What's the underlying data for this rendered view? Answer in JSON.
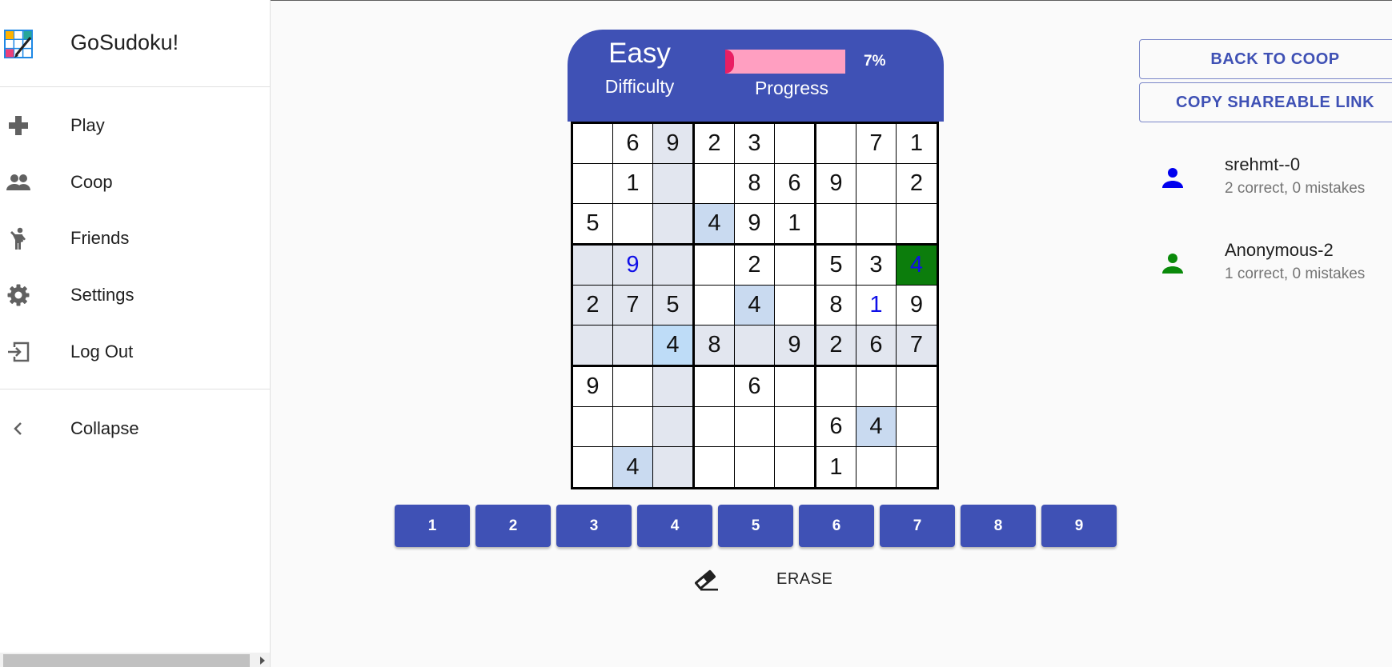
{
  "app": {
    "title": "GoSudoku!"
  },
  "sidebar": {
    "items": [
      {
        "label": "Play",
        "icon": "gamepad-icon"
      },
      {
        "label": "Coop",
        "icon": "people-icon"
      },
      {
        "label": "Friends",
        "icon": "person-waving-icon"
      },
      {
        "label": "Settings",
        "icon": "gear-icon"
      },
      {
        "label": "Log Out",
        "icon": "logout-icon"
      }
    ],
    "collapse": {
      "label": "Collapse",
      "icon": "chevron-left-icon"
    }
  },
  "game": {
    "difficulty_value": "Easy",
    "difficulty_label": "Difficulty",
    "progress_label": "Progress",
    "progress_percent": 7,
    "progress_text": "7%"
  },
  "board": {
    "values": [
      [
        "",
        "6",
        "9",
        "2",
        "3",
        "",
        "",
        "7",
        "1"
      ],
      [
        "",
        "1",
        "",
        "",
        "8",
        "6",
        "9",
        "",
        "2"
      ],
      [
        "5",
        "",
        "",
        "4",
        "9",
        "1",
        "",
        "",
        ""
      ],
      [
        "",
        "9",
        "",
        "",
        "2",
        "",
        "5",
        "3",
        "4"
      ],
      [
        "2",
        "7",
        "5",
        "",
        "4",
        "",
        "8",
        "1",
        "9"
      ],
      [
        "",
        "",
        "4",
        "8",
        "",
        "9",
        "2",
        "6",
        "7"
      ],
      [
        "9",
        "",
        "",
        "",
        "6",
        "",
        "",
        "",
        ""
      ],
      [
        "",
        "",
        "",
        "",
        "",
        "",
        "6",
        "4",
        ""
      ],
      [
        "",
        "4",
        "",
        "",
        "",
        "",
        "1",
        "",
        ""
      ]
    ],
    "user_entries": [
      [
        3,
        1
      ],
      [
        3,
        8
      ],
      [
        4,
        7
      ]
    ],
    "selected": [
      5,
      2
    ],
    "correct_cells": [
      [
        3,
        8
      ]
    ],
    "highlight_color": "#e2e6ef",
    "match_color": "#c9daf0",
    "selected_color": "#bedcf7",
    "correct_color": "#0c7d0c",
    "user_text_color": "#1010e8"
  },
  "numpad": {
    "buttons": [
      "1",
      "2",
      "3",
      "4",
      "5",
      "6",
      "7",
      "8",
      "9"
    ]
  },
  "actions": {
    "erase_label": "ERASE",
    "erase_icon": "eraser-icon"
  },
  "coop": {
    "back_label": "BACK TO COOP",
    "copy_link_label": "COPY SHAREABLE LINK",
    "players": [
      {
        "name": "srehmt--0",
        "stats": "2 correct, 0 mistakes",
        "color": "#0000ee"
      },
      {
        "name": "Anonymous-2",
        "stats": "1 correct, 0 mistakes",
        "color": "#0a8a0a"
      }
    ]
  },
  "theme": {
    "primary": "#3f51b5",
    "progress_track": "#ff9fc1",
    "progress_fill": "#e91e63"
  }
}
